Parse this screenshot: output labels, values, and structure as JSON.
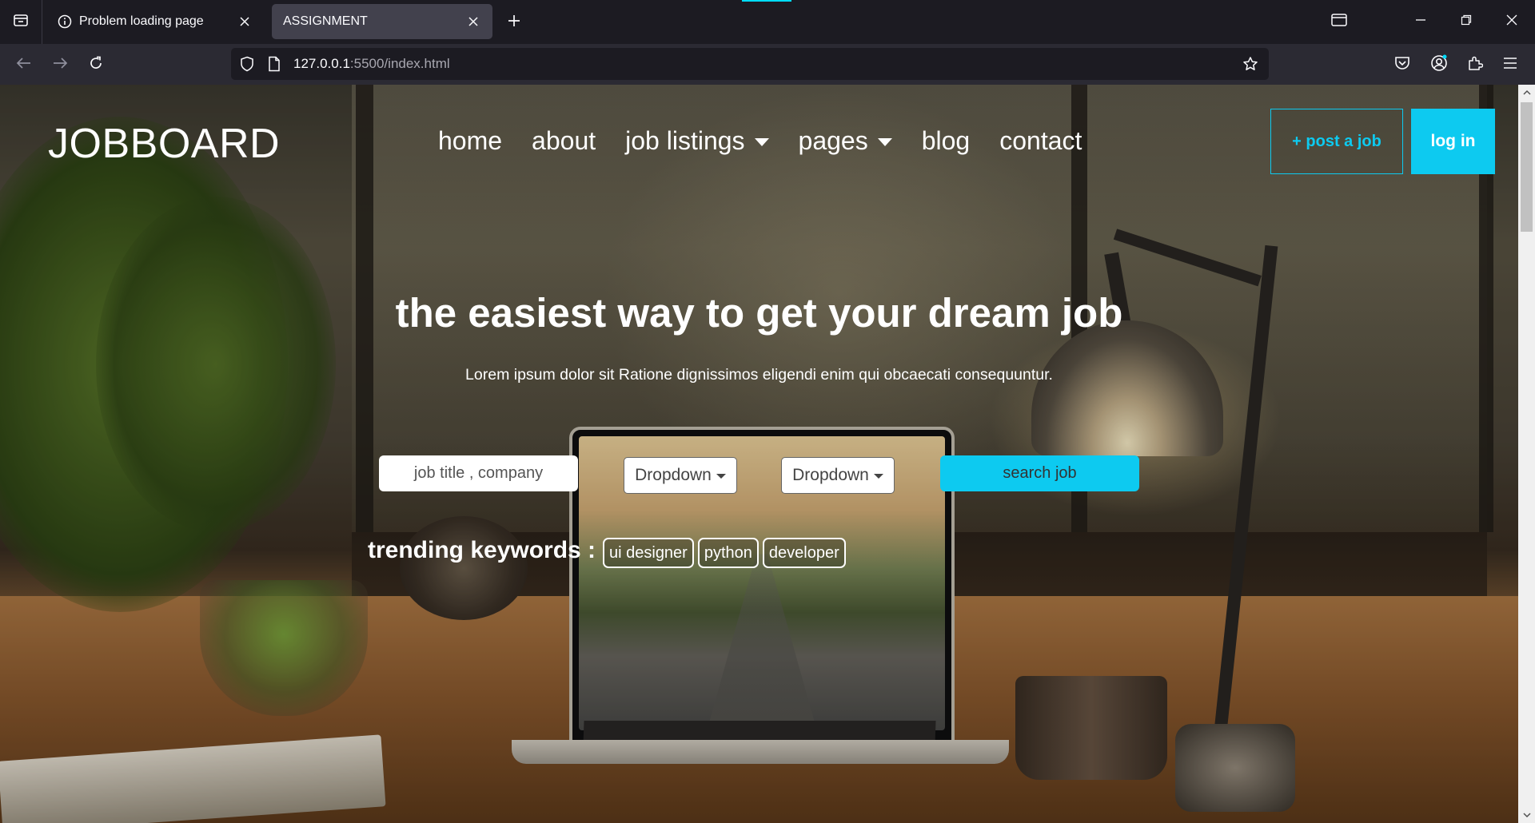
{
  "browser": {
    "tabs": [
      {
        "title": "Problem loading page",
        "icon": "info-icon",
        "active": false
      },
      {
        "title": "ASSIGNMENT",
        "icon": "",
        "active": true
      }
    ],
    "url": {
      "host": "127.0.0.1",
      "rest": ":5500/index.html"
    },
    "accent_color": "#00ddff"
  },
  "site": {
    "logo": "JOBBOARD",
    "nav": [
      {
        "label": "home",
        "has_dropdown": false
      },
      {
        "label": "about",
        "has_dropdown": false
      },
      {
        "label": "job listings",
        "has_dropdown": true
      },
      {
        "label": "pages",
        "has_dropdown": true
      },
      {
        "label": "blog",
        "has_dropdown": false
      },
      {
        "label": "contact",
        "has_dropdown": false
      }
    ],
    "post_job_label": "+ post a job",
    "login_label": "log in",
    "brand_color": "#0dcaf0"
  },
  "hero": {
    "title": "the easiest way to get your dream job",
    "subtitle": "Lorem ipsum dolor sit Ratione dignissimos eligendi enim qui obcaecati consequuntur."
  },
  "search": {
    "placeholder": "job title , company",
    "dropdown1": "Dropdown",
    "dropdown2": "Dropdown",
    "button": "search job"
  },
  "trending": {
    "label": "trending keywords :",
    "tags": [
      "ui designer",
      "python",
      "developer"
    ]
  }
}
